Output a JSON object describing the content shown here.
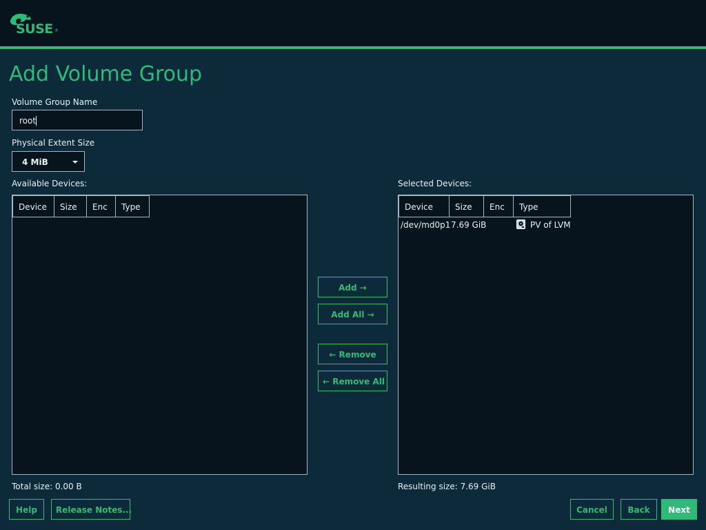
{
  "brand": {
    "logo_text": "SUSE",
    "logo_mark": "®"
  },
  "page_title": "Add Volume Group",
  "vg_name": {
    "label": "Volume Group Name",
    "value": "root"
  },
  "extent": {
    "label": "Physical Extent Size",
    "value": "4 MiB"
  },
  "available": {
    "label": "Available Devices:",
    "columns": [
      "Device",
      "Size",
      "Enc",
      "Type"
    ],
    "rows": [],
    "total_label": "Total size: 0.00 B"
  },
  "selected": {
    "label": "Selected Devices:",
    "columns": [
      "Device",
      "Size",
      "Enc",
      "Type"
    ],
    "rows": [
      {
        "device": "/dev/md0p1",
        "size": "7.69 GiB",
        "enc": "",
        "type": "PV of LVM",
        "type_icon": "harddisk-icon"
      }
    ],
    "resulting_label": "Resulting size: 7.69 GiB"
  },
  "move_buttons": {
    "add": "Add →",
    "add_all": "Add All →",
    "remove": "← Remove",
    "remove_all": "← Remove All"
  },
  "footer": {
    "help": "Help",
    "release_notes": "Release Notes...",
    "cancel": "Cancel",
    "back": "Back",
    "next": "Next"
  },
  "colors": {
    "accent": "#30ba78",
    "background": "#0c2a3a",
    "panel": "#07141d",
    "header": "#07141d"
  }
}
